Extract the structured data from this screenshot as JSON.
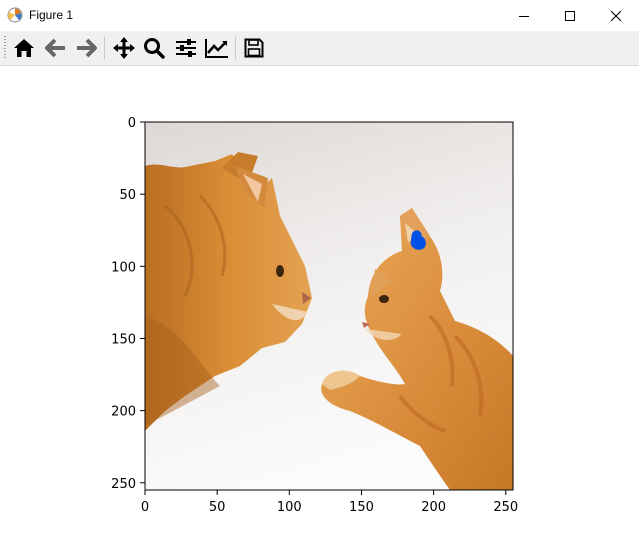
{
  "window": {
    "title": "Figure 1",
    "app_icon": "matplotlib-icon",
    "controls": [
      "minimize-icon",
      "maximize-icon",
      "close-icon"
    ]
  },
  "toolbar": {
    "buttons": [
      "home-icon",
      "back-icon",
      "forward-icon",
      "pan-icon",
      "zoom-icon",
      "configure-subplots-icon",
      "edit-axis-icon",
      "save-icon"
    ]
  },
  "chart_data": {
    "type": "image",
    "image_content": "two orange tabby cats facing each other, kitten raising a paw",
    "marker": {
      "shape": "filled blob",
      "color": "#0050e6",
      "x": 189,
      "y": 82
    },
    "xlim": [
      0,
      255
    ],
    "ylim": [
      255,
      0
    ],
    "xticks": [
      0,
      50,
      100,
      150,
      200,
      250
    ],
    "yticks": [
      0,
      50,
      100,
      150,
      200,
      250
    ],
    "xtick_labels": [
      "0",
      "50",
      "100",
      "150",
      "200",
      "250"
    ],
    "ytick_labels": [
      "0",
      "50",
      "100",
      "150",
      "200",
      "250"
    ]
  }
}
